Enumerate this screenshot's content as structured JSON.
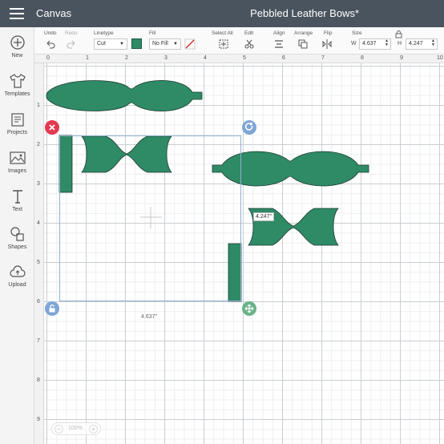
{
  "header": {
    "title": "Canvas",
    "project": "Pebbled Leather Bows*"
  },
  "rail": [
    {
      "label": "New"
    },
    {
      "label": "Templates"
    },
    {
      "label": "Projects"
    },
    {
      "label": "Images"
    },
    {
      "label": "Text"
    },
    {
      "label": "Shapes"
    },
    {
      "label": "Upload"
    }
  ],
  "toolbar": {
    "undo_label": "Undo",
    "redo_label": "Redo",
    "linetype_label": "Linetype",
    "linetype_value": "Cut",
    "fill_label": "Fill",
    "fill_value": "No Fill",
    "select_all_label": "Select All",
    "edit_label": "Edit",
    "align_label": "Align",
    "arrange_label": "Arrange",
    "flip_label": "Flip",
    "size_label": "Size",
    "w_label": "W",
    "w_value": "4.637",
    "h_label": "H",
    "h_value": "4.247",
    "linetype_color": "#2f8a66"
  },
  "ruler": {
    "top": [
      "0",
      "1",
      "2",
      "3",
      "4",
      "5",
      "6",
      "7",
      "8",
      "9",
      "10"
    ],
    "left": [
      "1",
      "2",
      "3",
      "4",
      "5",
      "6",
      "7",
      "8",
      "9"
    ]
  },
  "canvas": {
    "width_label": "4.637\"",
    "height_label": "4.247\""
  },
  "zoom": {
    "value": "100%"
  },
  "colors": {
    "shape_fill": "#2f8a66",
    "header_bg": "#4a545e"
  }
}
